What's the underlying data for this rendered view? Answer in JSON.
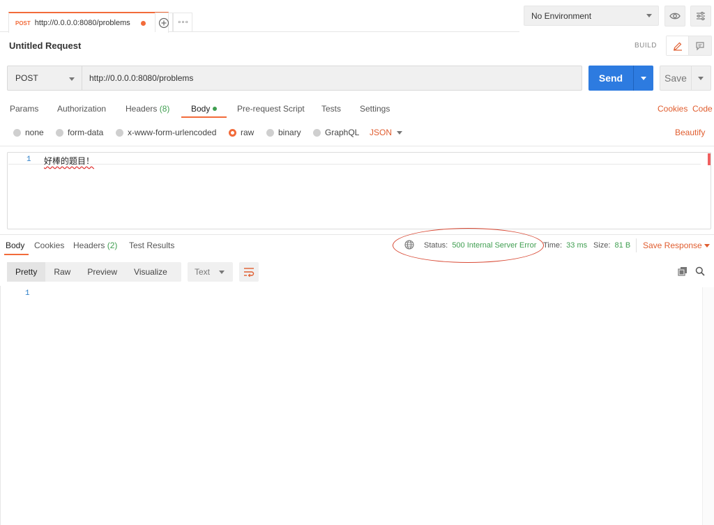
{
  "tabs": {
    "request_tab": {
      "method": "POST",
      "url": "http://0.0.0.0:8080/problems"
    },
    "more_label": "∘∘∘"
  },
  "environment": {
    "selected": "No Environment"
  },
  "request": {
    "title": "Untitled Request",
    "mode_label": "BUILD",
    "method": "POST",
    "url": "http://0.0.0.0:8080/problems",
    "send_label": "Send",
    "save_label": "Save"
  },
  "request_tabs": {
    "params": "Params",
    "authorization": "Authorization",
    "headers": "Headers",
    "headers_count": "(8)",
    "body": "Body",
    "pre_request": "Pre-request Script",
    "tests": "Tests",
    "settings": "Settings",
    "cookies": "Cookies",
    "code": "Code"
  },
  "body_types": {
    "none": "none",
    "form_data": "form-data",
    "urlencoded": "x-www-form-urlencoded",
    "raw": "raw",
    "binary": "binary",
    "graphql": "GraphQL",
    "format": "JSON",
    "beautify": "Beautify",
    "selected": "raw"
  },
  "editor": {
    "lines": [
      {
        "number": "1",
        "text": "好棒的题目！"
      }
    ]
  },
  "response": {
    "tabs": {
      "body": "Body",
      "cookies": "Cookies",
      "headers": "Headers",
      "headers_count": "(2)",
      "test_results": "Test Results"
    },
    "status_label": "Status:",
    "status_value": "500 Internal Server Error",
    "time_label": "Time:",
    "time_value": "33 ms",
    "size_label": "Size:",
    "size_value": "81 B",
    "save_response": "Save Response",
    "views": {
      "pretty": "Pretty",
      "raw": "Raw",
      "preview": "Preview",
      "visualize": "Visualize",
      "selected": "Pretty"
    },
    "format": "Text",
    "lines": [
      {
        "number": "1"
      }
    ]
  },
  "colors": {
    "accent_orange": "#f26b3a",
    "send_blue": "#2d7be0",
    "status_green": "#3f9e50",
    "annotation_red": "#d94a35",
    "line_number_blue": "#2a7dc7"
  },
  "annotation": {
    "shape": "ellipse",
    "target": "response-status"
  }
}
